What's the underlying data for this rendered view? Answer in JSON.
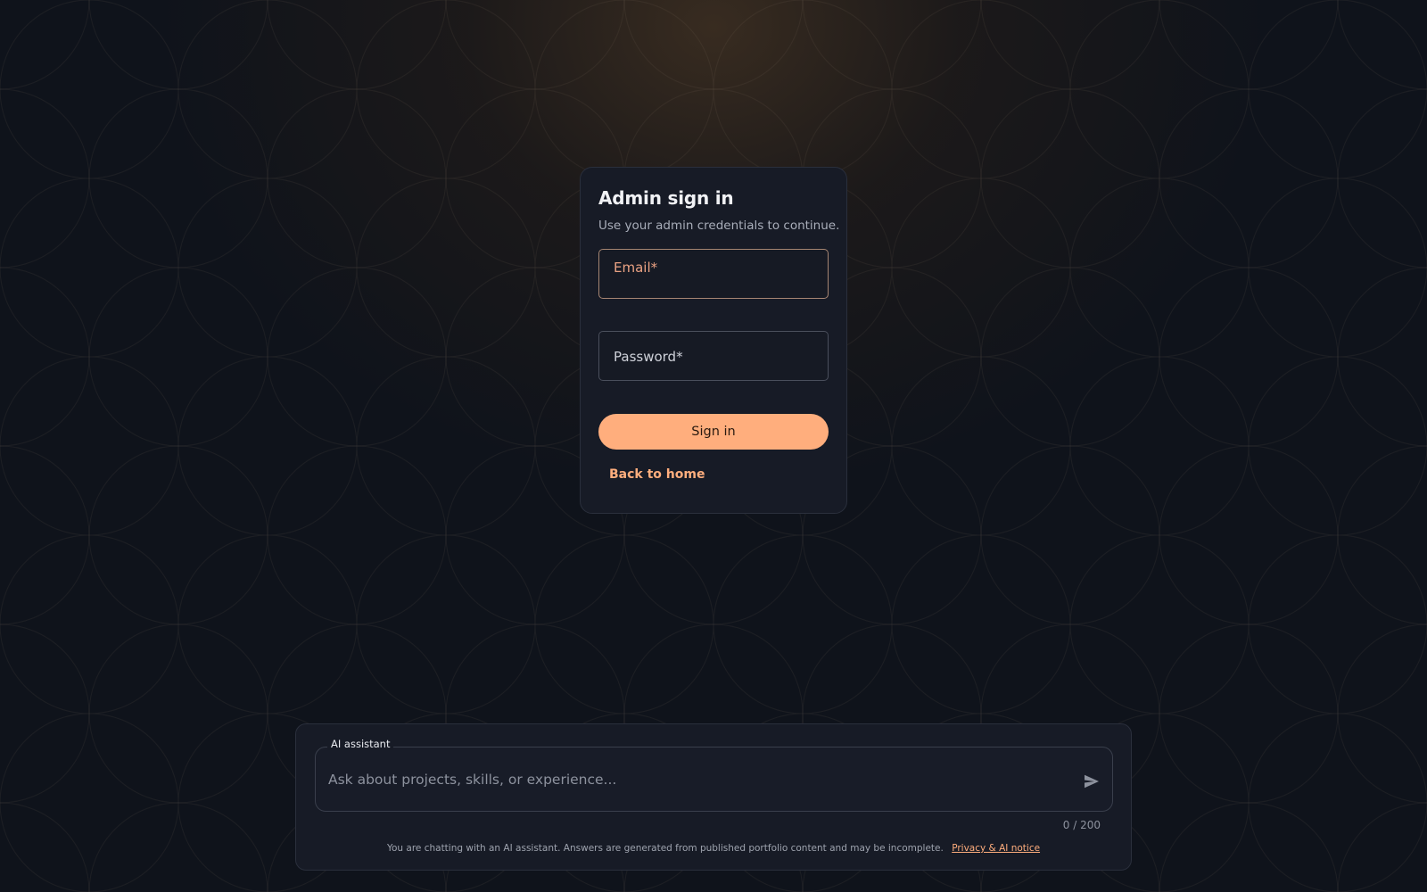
{
  "login": {
    "title": "Admin sign in",
    "subtitle": "Use your admin credentials to continue.",
    "email_label": "Email*",
    "email_value": "",
    "password_label": "Password*",
    "password_value": "",
    "signin_label": "Sign in",
    "back_label": "Back to home"
  },
  "assistant": {
    "legend": "AI assistant",
    "placeholder": "Ask about projects, skills, or experience...",
    "value": "",
    "send_icon": "send-icon",
    "counter": "0 / 200",
    "disclaimer": "You are chatting with an AI assistant. Answers are generated from published portfolio content and may be incomplete.",
    "privacy_link": "Privacy & AI notice"
  },
  "colors": {
    "accent": "#ffae7d",
    "card_bg": "#171b26",
    "page_bg": "#0f131b"
  }
}
